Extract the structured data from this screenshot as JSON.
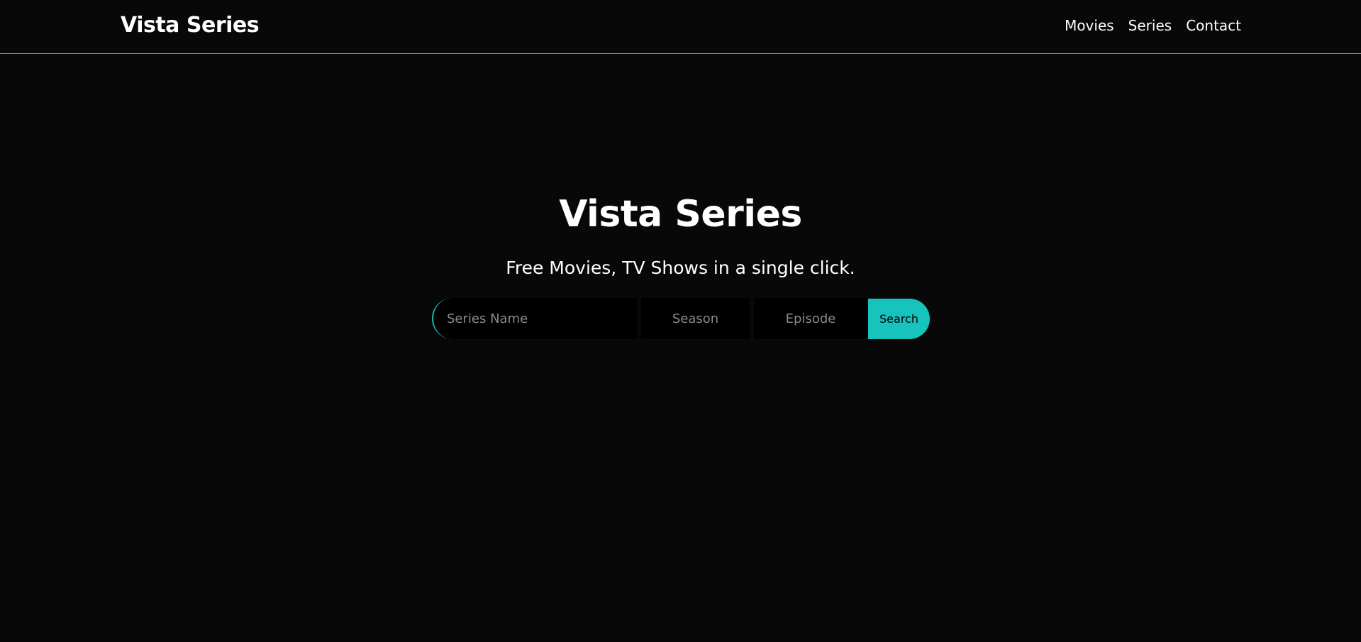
{
  "header": {
    "brand": "Vista Series",
    "nav": [
      "Movies",
      "Series",
      "Contact"
    ]
  },
  "hero": {
    "title": "Vista Series",
    "subtitle": "Free Movies, TV Shows in a single click."
  },
  "search": {
    "series_placeholder": "Series Name",
    "season_placeholder": "Season",
    "episode_placeholder": "Episode",
    "button_label": "Search"
  },
  "colors": {
    "background": "#080808",
    "accent": "#17c3bd",
    "text": "#ffffff"
  }
}
